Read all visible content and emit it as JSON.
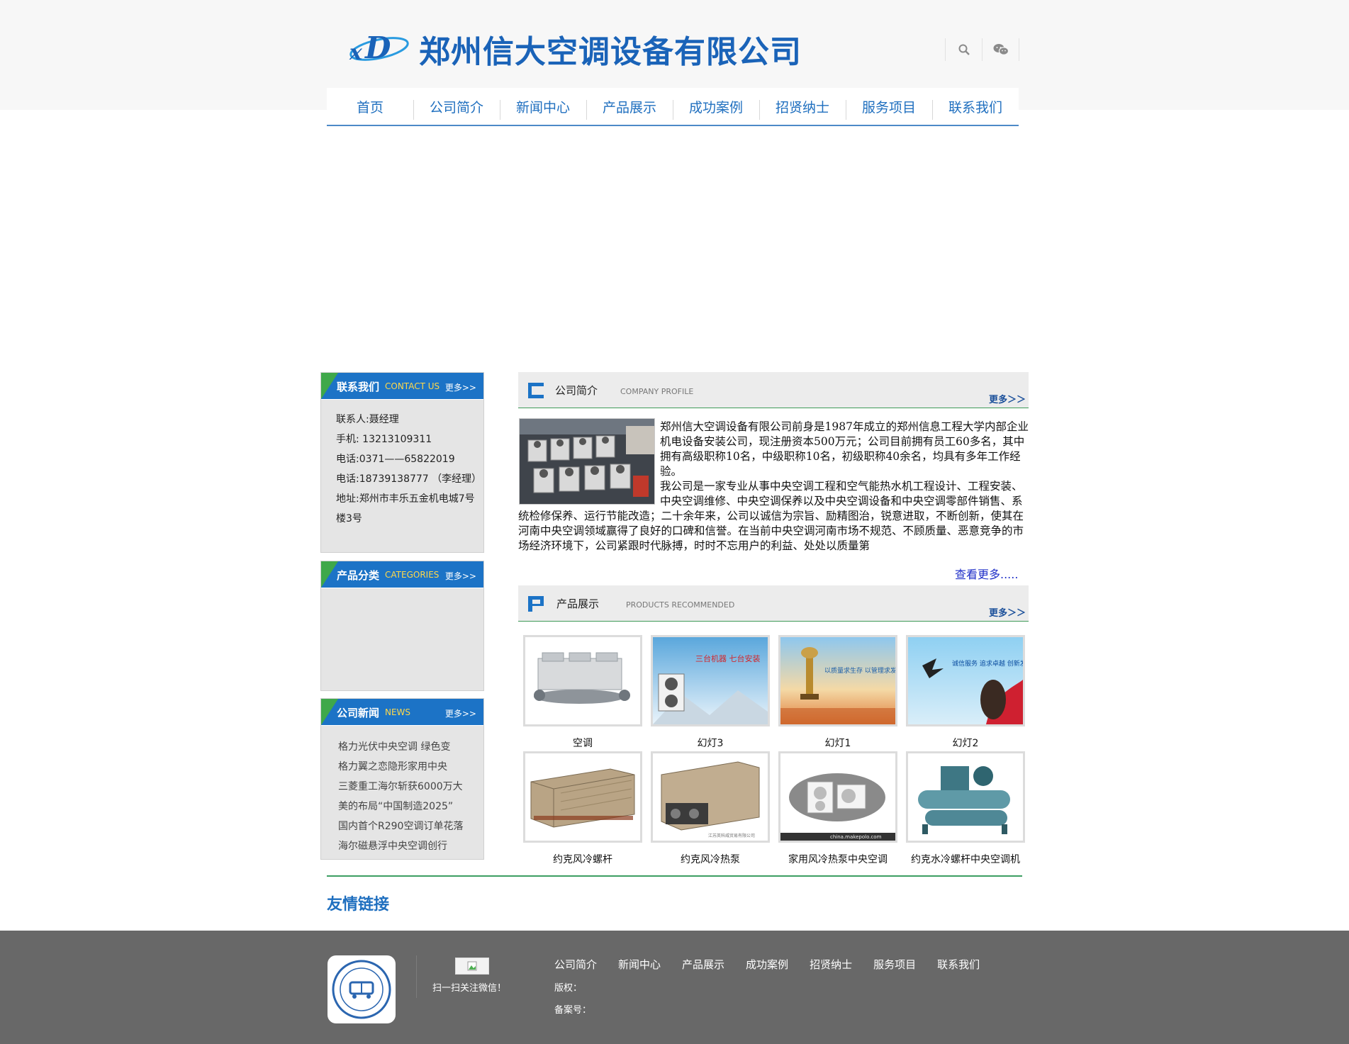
{
  "header": {
    "company_name": "郑州信大空调设备有限公司",
    "logo_letters": "xD"
  },
  "nav": [
    {
      "label": "首页"
    },
    {
      "label": "公司简介"
    },
    {
      "label": "新闻中心"
    },
    {
      "label": "产品展示"
    },
    {
      "label": "成功案例"
    },
    {
      "label": "招贤纳士"
    },
    {
      "label": "服务项目"
    },
    {
      "label": "联系我们"
    }
  ],
  "sidebar": {
    "contact": {
      "title": "联系我们",
      "title_en": "CONTACT US",
      "more": "更多>>",
      "lines": [
        "联系人:聂经理",
        "手机: 13213109311",
        "电话:0371——65822019",
        "电话:18739138777 （李经理）",
        "地址:郑州市丰乐五金机电城7号楼3号"
      ]
    },
    "categories": {
      "title": "产品分类",
      "title_en": "CATEGORIES",
      "more": "更多>>"
    },
    "news": {
      "title": "公司新闻",
      "title_en": "NEWS",
      "more": "更多>>",
      "items": [
        "格力光伏中央空调 绿色变",
        "格力翼之恋隐形家用中央",
        "三菱重工海尔斩获6000万大",
        "美的布局“中国制造2025”",
        "国内首个R290空调订单花落",
        "海尔磁悬浮中央空调创行"
      ]
    }
  },
  "about": {
    "title": "公司简介",
    "title_en": "COMPANY PROFILE",
    "more": "更多＞＞",
    "para1": "郑州信大空调设备有限公司前身是1987年成立的郑州信息工程大学内部企业机电设备安装公司，现注册资本500万元；公司目前拥有员工60多名，其中拥有高级职称10名，中级职称10名，初级职称40余名，均具有多年工作经验。",
    "para2": "我公司是一家专业从事中央空调工程和空气能热水机工程设计、工程安装、中央空调维修、中央空调保养以及中央空调设备和中央空调零部件销售、系统检修保养、运行节能改造；二十余年来，公司以诚信为宗旨、励精图治，锐意进取，不断创新，使其在河南中央空调领域赢得了良好的口碑和信誉。在当前中央空调河南市场不规范、不顾质量、恶意竞争的市场经济环境下，公司紧跟时代脉搏，时时不忘用户的利益、处处以质量第",
    "see_more": "查看更多....."
  },
  "products": {
    "title": "产品展示",
    "title_en": "PRODUCTS RECOMMENDED",
    "more": "更多＞＞",
    "items": [
      {
        "name": "空调"
      },
      {
        "name": "幻灯3",
        "banner": "三台机器 七台安装"
      },
      {
        "name": "幻灯1",
        "banner": "以质量求生存 以管理求发展"
      },
      {
        "name": "幻灯2",
        "banner": "诚信服务 追求卓越 创新发展 合作共赢"
      },
      {
        "name": "约克风冷螺杆"
      },
      {
        "name": "约克风冷热泵"
      },
      {
        "name": "家用风冷热泵中央空调",
        "watermark": "china.makepolo.com"
      },
      {
        "name": "约克水冷螺杆中央空调机"
      }
    ]
  },
  "links": {
    "title": "友情链接"
  },
  "footer": {
    "scan_text": "扫一扫关注微信！",
    "nav": [
      "公司简介",
      "新闻中心",
      "产品展示",
      "成功案例",
      "招贤纳士",
      "服务项目",
      "联系我们"
    ],
    "copyright": "版权：",
    "icp": "备案号："
  },
  "colors": {
    "brand_blue": "#1a63b8",
    "nav_blue": "#1f6fbf",
    "sidebar_head": "#1c73c6",
    "accent_green": "#3e9a58",
    "footer_bg": "#686868"
  }
}
